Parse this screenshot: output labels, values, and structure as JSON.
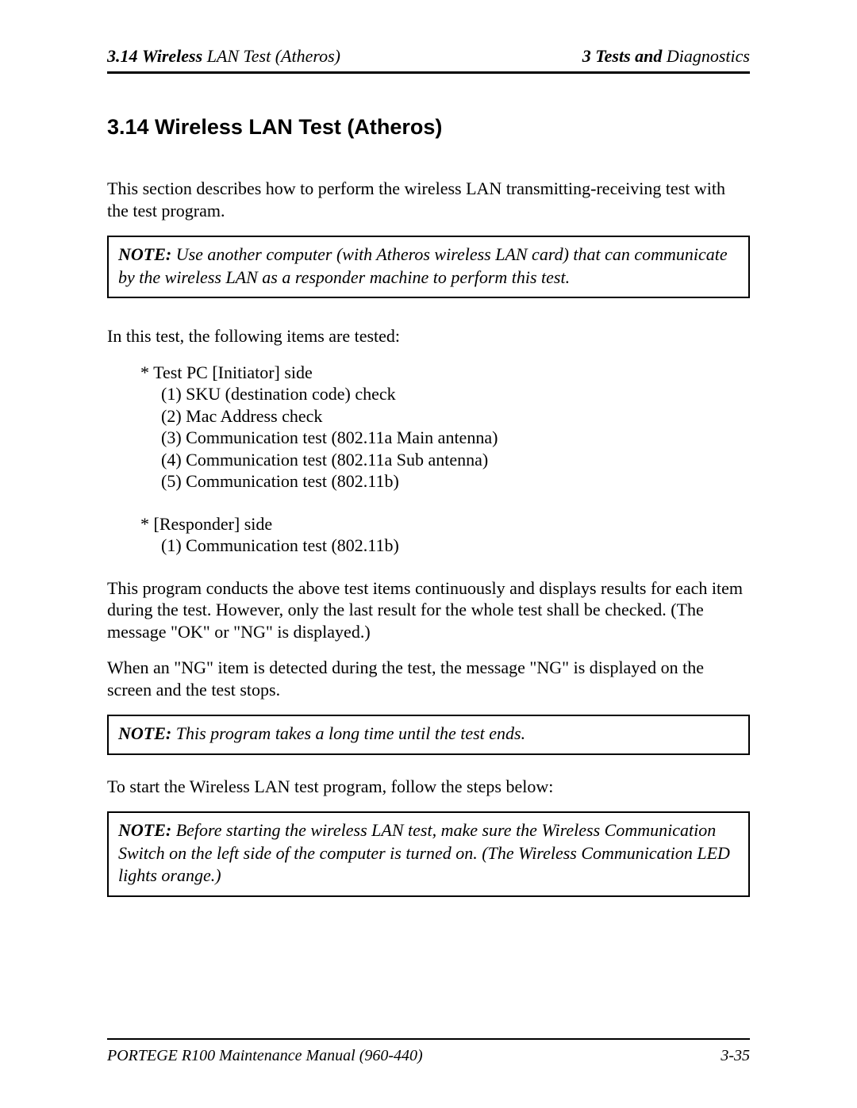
{
  "header": {
    "left_sec": "3.14",
    "left_wireless": "Wireless",
    "left_rest": " LAN Test  (Atheros)",
    "right_three": "3 ",
    "right_tests": "Tests and",
    "right_diag": " Diagnostics"
  },
  "heading": "3.14  Wireless LAN Test  (Atheros)",
  "intro": "This section describes how to perform the wireless LAN transmitting-receiving test with the test program.",
  "note1_label": "NOTE:",
  "note1_text": "  Use another computer (with Atheros wireless LAN card) that can communicate by the wireless LAN as a responder machine to perform this test.",
  "para2": "In this test, the following items are tested:",
  "initiator_header": "* Test PC [Initiator] side",
  "initiator_items": [
    "(1) SKU (destination code) check",
    "(2) Mac Address check",
    "(3) Communication test (802.11a Main antenna)",
    "(4) Communication test (802.11a Sub antenna)",
    "(5) Communication test (802.11b)"
  ],
  "responder_header": "* [Responder] side",
  "responder_items": [
    "(1) Communication test (802.11b)"
  ],
  "para3": "This program conducts the above test items continuously and displays results for each item during the test. However, only the last result for the whole test shall be checked. (The message \"OK\" or \"NG\" is displayed.)",
  "para4": "When an \"NG\" item is detected during the test, the message \"NG\" is displayed on the screen and the test stops.",
  "note2_label": "NOTE:",
  "note2_text": "  This program takes a long time until the test ends.",
  "para5": "To start the Wireless LAN test program, follow the steps below:",
  "note3_label": "NOTE:",
  "note3_text": "  Before starting the wireless LAN test, make sure the Wireless Communication Switch on the left side of the computer is turned on. (The Wireless Communication LED lights orange.)",
  "footer_left": "PORTEGE R100 Maintenance Manual (960-440)",
  "footer_right": "3-35"
}
